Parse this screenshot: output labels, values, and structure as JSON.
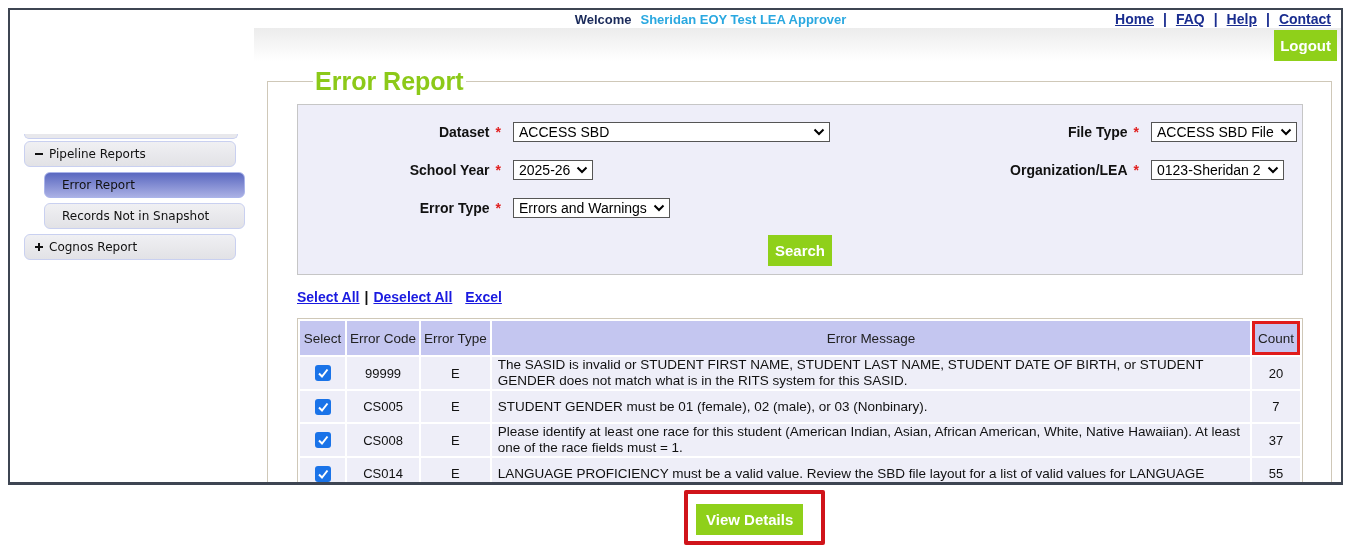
{
  "header": {
    "welcome_label": "Welcome",
    "user_name": "Sheridan EOY Test LEA Approver",
    "links": [
      {
        "kind": "link",
        "text": "Home"
      },
      {
        "kind": "separator",
        "text": "|"
      },
      {
        "kind": "link",
        "text": "FAQ"
      },
      {
        "kind": "separator",
        "text": "|"
      },
      {
        "kind": "link",
        "text": "Help"
      },
      {
        "kind": "separator",
        "text": "|"
      },
      {
        "kind": "link",
        "text": "Contact"
      }
    ],
    "logout_button": "Logout"
  },
  "sidebar": {
    "items": [
      {
        "label": "Pipeline Reports",
        "expanded": true,
        "children": [
          {
            "label": "Error Report",
            "selected": true
          },
          {
            "label": "Records Not in Snapshot",
            "selected": false
          }
        ]
      },
      {
        "label": "Cognos Report",
        "expanded": false
      }
    ]
  },
  "page_title": "Error Report",
  "filters": {
    "left": [
      {
        "label": "Dataset",
        "required_mark": "*",
        "value": "ACCESS SBD"
      },
      {
        "label": "School Year",
        "required_mark": "*",
        "value": "2025-26"
      },
      {
        "label": "Error Type",
        "required_mark": "*",
        "value": "Errors and Warnings"
      }
    ],
    "right": [
      {
        "label": "File Type",
        "required_mark": "*",
        "value": "ACCESS SBD File"
      },
      {
        "label": "Organization/LEA",
        "required_mark": "*",
        "value": "0123-Sheridan 2"
      }
    ]
  },
  "search_button": "Search",
  "table_links": [
    {
      "kind": "link",
      "text": "Select All"
    },
    {
      "kind": "separator",
      "text": "|"
    },
    {
      "kind": "link",
      "text": "Deselect All"
    },
    {
      "kind": "link",
      "text": "Excel"
    }
  ],
  "table": {
    "columns": [
      {
        "label": "Select",
        "highlighted": false
      },
      {
        "label": "Error Code",
        "highlighted": false
      },
      {
        "label": "Error Type",
        "highlighted": false
      },
      {
        "label": "Error Message",
        "highlighted": false
      },
      {
        "label": "Count",
        "highlighted": true
      }
    ],
    "rows": [
      {
        "checked": true,
        "code": "99999",
        "type": "E",
        "message": "The SASID is invalid or STUDENT FIRST NAME, STUDENT LAST NAME, STUDENT DATE OF BIRTH, or STUDENT GENDER does not match what is in the RITS system for this SASID.",
        "count": "20"
      },
      {
        "checked": true,
        "code": "CS005",
        "type": "E",
        "message": "STUDENT GENDER must be 01 (female), 02 (male), or 03 (Nonbinary).",
        "count": "7"
      },
      {
        "checked": true,
        "code": "CS008",
        "type": "E",
        "message": "Please identify at least one race for this student (American Indian, Asian, African American, White, Native Hawaiian). At least one of the race fields must = 1.",
        "count": "37"
      },
      {
        "checked": true,
        "code": "CS014",
        "type": "E",
        "message": "LANGUAGE PROFICIENCY must be a valid value. Review the SBD file layout for a list of valid values for LANGUAGE",
        "count": "55"
      }
    ]
  },
  "view_details_button": {
    "label": "View Details",
    "highlighted": true
  }
}
